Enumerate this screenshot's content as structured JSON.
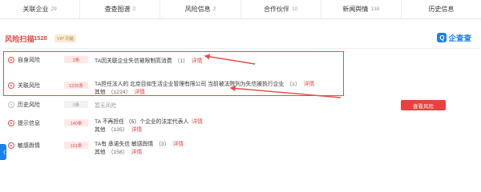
{
  "tabs": [
    {
      "label": "关联企业",
      "count": "29"
    },
    {
      "label": "查查图谱",
      "count": "2"
    },
    {
      "label": "风险信息",
      "count": "2"
    },
    {
      "label": "合作伙伴",
      "count": "10"
    },
    {
      "label": "新闻舆情",
      "count": "138"
    },
    {
      "label": "历史信息",
      "count": ""
    }
  ],
  "header": {
    "title": "风险扫描",
    "count": "1528",
    "vip": "VIP 功能",
    "brand_icon": "Q",
    "brand_text": "企查查"
  },
  "rows": [
    {
      "category": "自身风险",
      "count": "2条",
      "lines": [
        {
          "text": "TA因关联企业失信被限制高消费",
          "num": "（1）",
          "link": "详情"
        }
      ]
    },
    {
      "category": "关联风险",
      "count": "1225条",
      "lines": [
        {
          "text": "TA担任法人的 北京目如生活企业管理有限公司 当前被法院列为失信被执行企业",
          "num": "（1）",
          "link": "详情"
        },
        {
          "text": "其他",
          "num": "（1224）",
          "link": "详情"
        }
      ]
    },
    {
      "category": "历史风险",
      "count": "0条",
      "lines": [
        {
          "text": "暂无风险"
        }
      ]
    },
    {
      "category": "提示信息",
      "count": "140条",
      "lines": [
        {
          "text": "TA 不再担任 （5）个企业的法定代表人",
          "link": "详情"
        },
        {
          "text": "其他",
          "num": "（135）",
          "link": "详情"
        }
      ]
    },
    {
      "category": "敏感舆情",
      "count": "161条",
      "lines": [
        {
          "text": "TA有 承诺失信 敏感舆情",
          "num": "（3）",
          "link": "详情"
        },
        {
          "text": "其他",
          "num": "（158）",
          "link": "详情"
        }
      ]
    }
  ],
  "button": {
    "label": "查看风险"
  },
  "side_handle": {
    "label": "《"
  },
  "colors": {
    "accent": "#e8423f",
    "brand": "#1a7ff0",
    "annotation": "#e84a4a"
  }
}
